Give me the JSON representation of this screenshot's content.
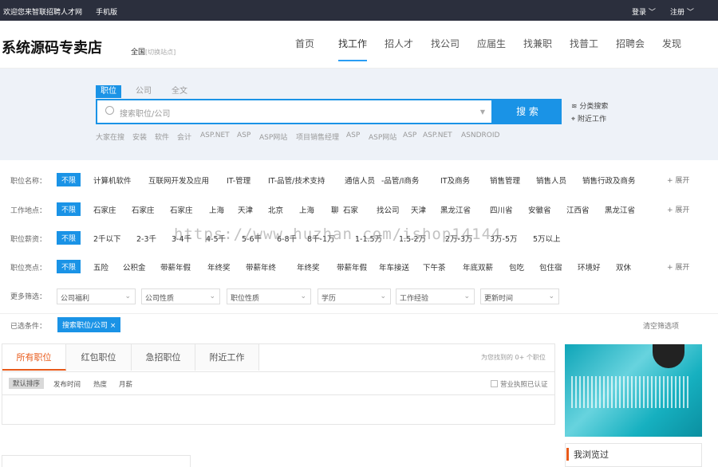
{
  "topbar": {
    "welcome": "欢迎您来智联招聘人才网",
    "mobile": "手机版",
    "login": "登录 ﹀",
    "register": "注册 ﹀"
  },
  "header": {
    "logo": "系统源码专卖店",
    "city": "全国",
    "city_switch": "[切换站点]",
    "nav": [
      "首页",
      "找工作",
      "招人才",
      "找公司",
      "应届生",
      "找兼职",
      "找普工",
      "招聘会",
      "发现"
    ],
    "nav_active": 1
  },
  "search": {
    "tabs": [
      "职位",
      "公司",
      "全文"
    ],
    "placeholder": "搜索职位/公司",
    "button": "搜 索",
    "side_category": "分类搜索",
    "side_nearby": "附近工作",
    "hot": [
      "大家在搜",
      "安装",
      "软件",
      "会计",
      "ASP.NET",
      "ASP",
      "ASP网站",
      "项目销售经理",
      "ASP",
      "ASP网站",
      "ASP",
      "ASP.NET",
      "ASNDROID"
    ]
  },
  "filters": [
    {
      "label": "职位名称：",
      "unlimited": "不限",
      "items": [
        "计算机软件",
        "互联网开发及应用",
        "IT-管理",
        "IT-品管/技术支持",
        "通信人员",
        "-品管/I商务",
        "IT及商务",
        "销售管理",
        "销售人员",
        "销售行政及商务"
      ],
      "expand": "+ 展开"
    },
    {
      "label": "工作地点：",
      "unlimited": "不限",
      "items": [
        "石家庄",
        "石家庄",
        "石家庄",
        "上海",
        "天津",
        "北京",
        "上海",
        "聊",
        "石家",
        "找公司",
        "天津",
        "黑龙江省",
        "四川省",
        "安徽省",
        "江西省",
        "黑龙江省"
      ],
      "expand": "+ 展开"
    },
    {
      "label": "职位薪资：",
      "unlimited": "不限",
      "items": [
        "2千以下",
        "2-3千",
        "3-4千",
        "4-5千",
        "5-6千",
        "6-8千",
        "8千-1万",
        "1-1.5万",
        "1.5-2万",
        "2万-3万",
        "3万-5万",
        "5万以上"
      ]
    },
    {
      "label": "职位亮点：",
      "unlimited": "不限",
      "items": [
        "五险",
        "公积金",
        "带薪年假",
        "年终奖",
        "带薪年终",
        "年终奖",
        "带薪年假",
        "年车接送",
        "下午茶",
        "年底双薪",
        "包吃",
        "包住宿",
        "环境好",
        "双休"
      ],
      "expand": "+ 展开"
    }
  ],
  "more": {
    "label": "更多筛选：",
    "selects": [
      "公司福利",
      "公司性质",
      "职位性质",
      "学历",
      "工作经验",
      "更新时间"
    ]
  },
  "chosen": {
    "label": "已选条件：",
    "tag": "搜索职位/公司 ×",
    "clear": "清空筛选项"
  },
  "jobs": {
    "tabs": [
      "所有职位",
      "红包职位",
      "急招职位",
      "附近工作"
    ],
    "found": "为您找到的 0+ 个职位",
    "sorts": [
      "默认排序",
      "发布时间",
      "热度",
      "月薪"
    ],
    "license": "营业执照已认证"
  },
  "sidebar": {
    "browsed": "我浏览过"
  },
  "watermark": "https://www.huzhan.com/ishop14144",
  "colors": {
    "primary": "#1a93e6",
    "accent": "#e85a1a",
    "topbar": "#2b2f3d"
  }
}
